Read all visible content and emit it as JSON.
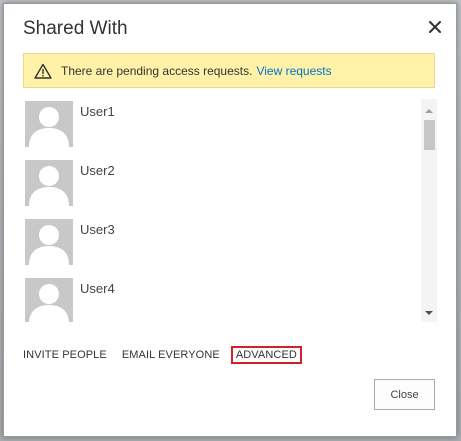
{
  "dialog": {
    "title": "Shared With",
    "close_icon": "close-x-icon"
  },
  "alert": {
    "icon": "warning-triangle-icon",
    "message": "There are pending access requests.",
    "link": "View requests"
  },
  "users": [
    {
      "name": "User1",
      "icon": "user-placeholder-icon"
    },
    {
      "name": "User2",
      "icon": "user-placeholder-icon"
    },
    {
      "name": "User3",
      "icon": "user-placeholder-icon"
    },
    {
      "name": "User4",
      "icon": "user-placeholder-icon"
    }
  ],
  "actions": {
    "invite": "INVITE PEOPLE",
    "email": "EMAIL EVERYONE",
    "advanced": "ADVANCED"
  },
  "footer": {
    "close_label": "Close"
  },
  "colors": {
    "alert_bg": "#fff2a8",
    "link": "#0072c6",
    "highlight": "#d2212a"
  }
}
